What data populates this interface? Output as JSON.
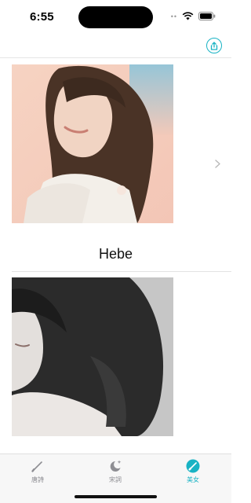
{
  "status_bar": {
    "time": "6:55",
    "icons": [
      "wifi-icon",
      "battery-icon"
    ]
  },
  "nav_bar": {
    "right_icon": "share-icon"
  },
  "feed": {
    "items": [
      {
        "caption": "Hebe",
        "photo": "portrait-woman-smiling"
      },
      {
        "caption": "",
        "photo": "portrait-woman-monochrome"
      }
    ]
  },
  "tab_bar": {
    "tabs": [
      {
        "label": "唐詩",
        "icon": "pencil-icon",
        "active": false
      },
      {
        "label": "宋詞",
        "icon": "moon-star-icon",
        "active": false
      },
      {
        "label": "美女",
        "icon": "brush-circle-icon",
        "active": true
      }
    ]
  },
  "colors": {
    "accent": "#19b3c4",
    "inactive": "#8e8e93",
    "separator": "#e3e3e3"
  }
}
